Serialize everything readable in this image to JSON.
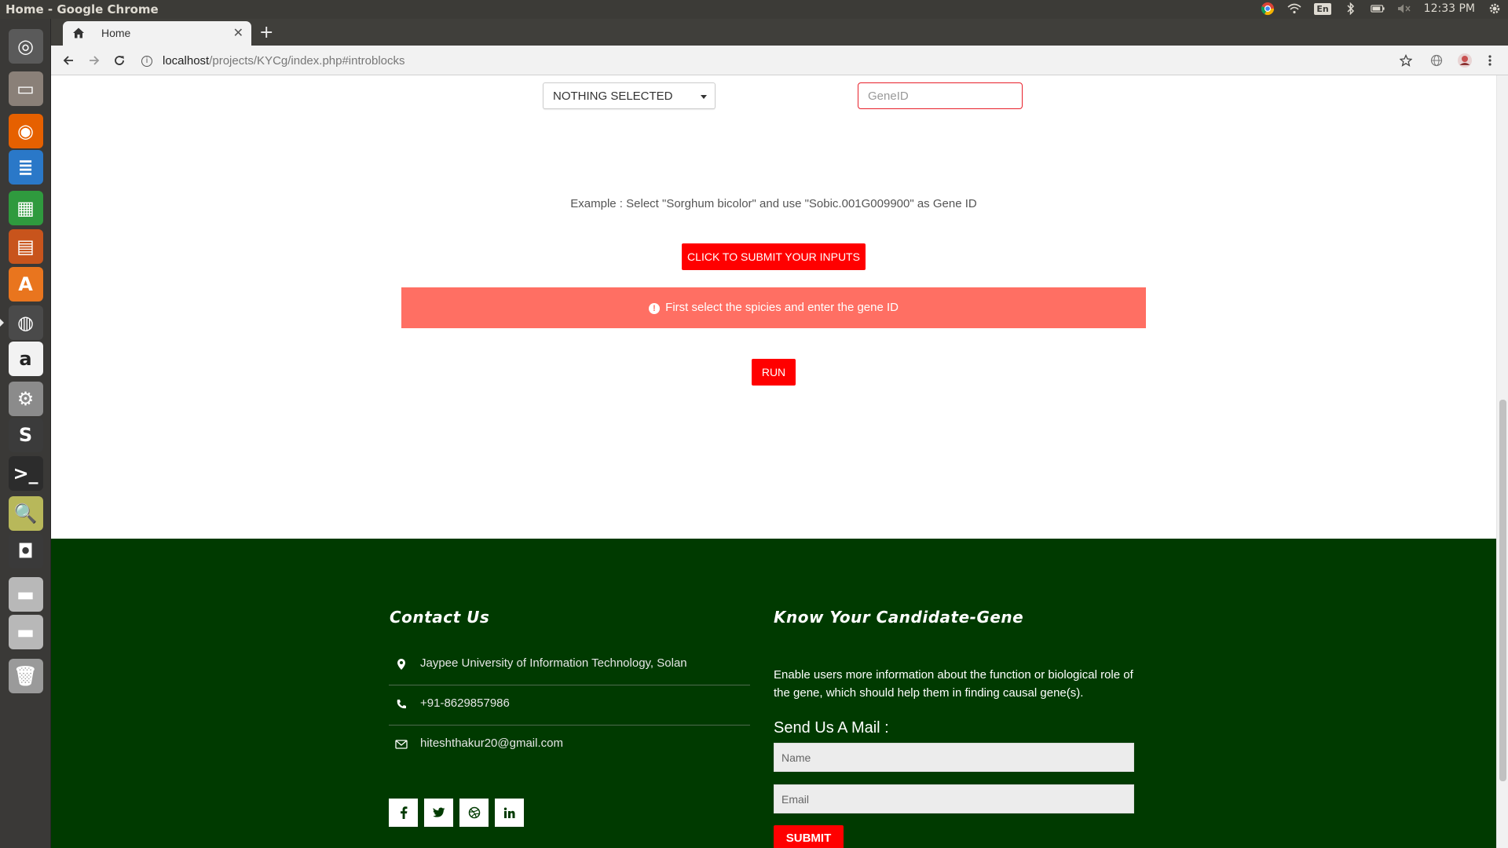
{
  "system": {
    "window_title": "Home - Google Chrome",
    "keyboard_layout": "En",
    "clock": "12:33 PM"
  },
  "launcher": {
    "items": [
      {
        "name": "ubuntu-dash",
        "color": "#5a5a5a"
      },
      {
        "name": "files",
        "color": "#8a8078"
      },
      {
        "name": "firefox",
        "color": "#e66000"
      },
      {
        "name": "libreoffice-writer",
        "color": "#2a78c8"
      },
      {
        "name": "libreoffice-calc",
        "color": "#2f9a3e"
      },
      {
        "name": "libreoffice-impress",
        "color": "#c8541c"
      },
      {
        "name": "ubuntu-software",
        "color": "#e9751e"
      },
      {
        "name": "chrome",
        "color": "#4a4a4a"
      },
      {
        "name": "amazon",
        "color": "#f2f2f2"
      },
      {
        "name": "system-settings",
        "color": "#8b8b8b"
      },
      {
        "name": "sublime-text",
        "color": "#3b3b3b"
      },
      {
        "name": "terminal",
        "color": "#2c2c2c"
      },
      {
        "name": "image-viewer",
        "color": "#b8b85a"
      },
      {
        "name": "disk-utility",
        "color": "#3a3a3a"
      },
      {
        "name": "drive-1",
        "color": "#b8b8b8"
      },
      {
        "name": "drive-2",
        "color": "#b8b8b8"
      },
      {
        "name": "trash",
        "color": "#9a9a9a"
      }
    ]
  },
  "browser": {
    "tab_title": "Home",
    "url_host": "localhost",
    "url_path": "/projects/KYCg/index.php#introblocks"
  },
  "page": {
    "species_select": "NOTHING SELECTED",
    "gene_placeholder": "GeneID",
    "example": "Example : Select \"Sorghum bicolor\" and use \"Sobic.001G009900\" as Gene ID",
    "submit_inputs_label": "CLICK TO SUBMIT YOUR INPUTS",
    "alert_text": "First select the spicies and enter the gene ID",
    "run_label": "RUN"
  },
  "footer": {
    "contact_heading": "Contact Us",
    "address": "Jaypee University of Information Technology, Solan",
    "phone": "+91-8629857986",
    "email": "hiteshthakur20@gmail.com",
    "social": [
      "f",
      "t",
      "d",
      "in"
    ],
    "about_heading": "Know Your Candidate-Gene",
    "about_text": "Enable users more information about the function or biological role of the gene, which should help them in finding causal gene(s).",
    "mail_heading": "Send Us A Mail :",
    "name_placeholder": "Name",
    "email_placeholder": "Email",
    "submit_label": "SUBMIT"
  },
  "colors": {
    "footer_bg": "#003a00",
    "button_red": "#ff0000",
    "alert_bg": "#ff6f63"
  }
}
